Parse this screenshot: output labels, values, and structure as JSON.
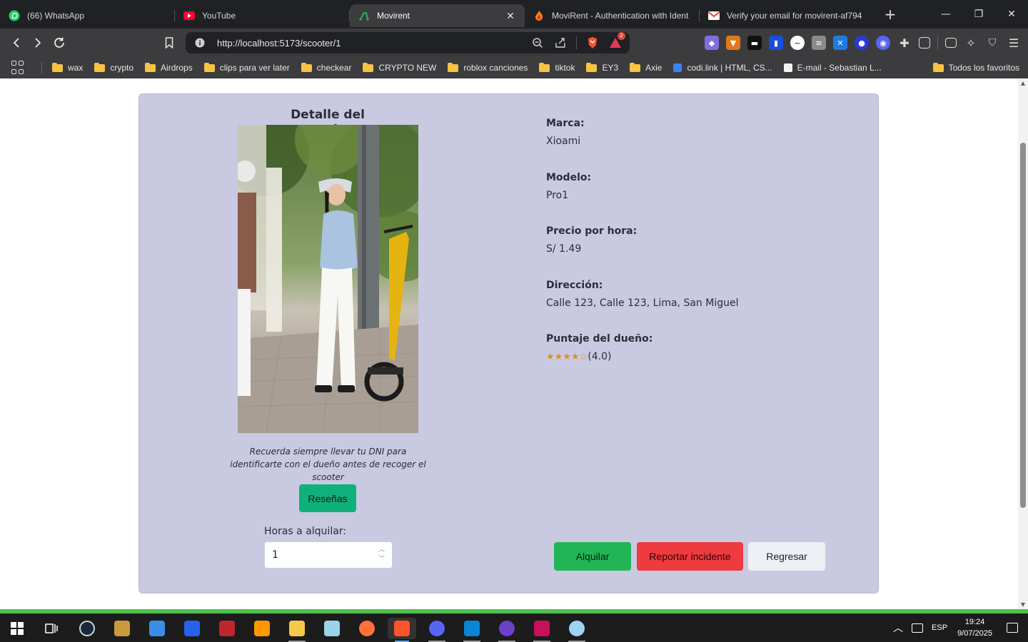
{
  "browser": {
    "tabs": [
      {
        "title": "(66) WhatsApp",
        "icon": "whatsapp-icon",
        "active": false
      },
      {
        "title": "YouTube",
        "icon": "youtube-icon",
        "active": false
      },
      {
        "title": "Movirent",
        "icon": "movirent-icon",
        "active": true
      },
      {
        "title": "MoviRent - Authentication with Ident",
        "icon": "firebase-icon",
        "active": false
      },
      {
        "title": "Verify your email for movirent-af794",
        "icon": "gmail-icon",
        "active": false
      }
    ],
    "url": "http://localhost:5173/scooter/1",
    "shields_count": "2",
    "bookmarks": [
      {
        "label": "wax",
        "type": "folder"
      },
      {
        "label": "crypto",
        "type": "folder"
      },
      {
        "label": "Airdrops",
        "type": "folder"
      },
      {
        "label": "clips para ver later",
        "type": "folder"
      },
      {
        "label": "checkear",
        "type": "folder"
      },
      {
        "label": "CRYPTO NEW",
        "type": "folder"
      },
      {
        "label": "roblox canciones",
        "type": "folder"
      },
      {
        "label": "tiktok",
        "type": "folder"
      },
      {
        "label": "EY3",
        "type": "folder"
      },
      {
        "label": "Axie",
        "type": "folder"
      },
      {
        "label": "codi.link | HTML, CS...",
        "type": "link"
      },
      {
        "label": "E-mail - Sebastian L...",
        "type": "link"
      }
    ],
    "all_bookmarks": "Todos los favoritos"
  },
  "page": {
    "title": "Detalle del scooter",
    "note": "Recuerda siempre llevar tu DNI para identificarte con el dueño antes de recoger el scooter",
    "reviews_button": "Reseñas",
    "hours_label": "Horas a alquilar:",
    "hours_value": "1",
    "fields": {
      "brand_label": "Marca:",
      "brand_value": "Xioami",
      "model_label": "Modelo:",
      "model_value": "Pro1",
      "price_label": "Precio por hora:",
      "price_value": "S/ 1.49",
      "address_label": "Dirección:",
      "address_value": "Calle 123, Calle 123, Lima, San Miguel",
      "rating_label": "Puntaje del dueño:",
      "rating_stars": "★★★★☆",
      "rating_value": "(4.0)"
    },
    "buttons": {
      "rent": "Alquilar",
      "report": "Reportar incidente",
      "back": "Regresar"
    }
  },
  "taskbar": {
    "language": "ESP",
    "time": "19:24",
    "date": "9/07/2025"
  }
}
